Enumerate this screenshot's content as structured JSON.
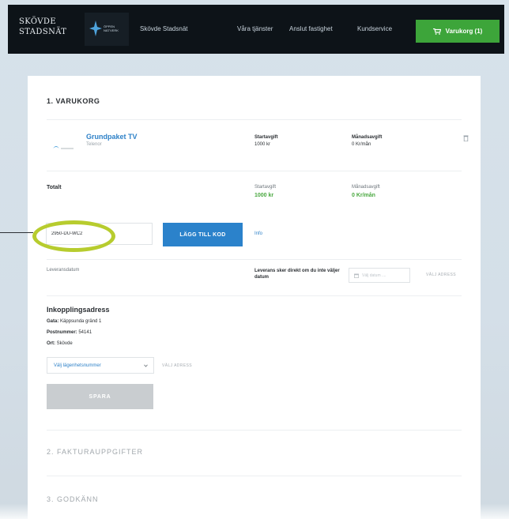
{
  "header": {
    "logo_line1": "SKÖVDE",
    "logo_line2": "STADSNÄT",
    "logo_mark_text": "ÖPPEN NÄTVERK",
    "nav": [
      "Skövde Stadsnät",
      "Våra tjänster",
      "Anslut fastighet",
      "Kundservice"
    ],
    "cart_label": "Varukorg (1)",
    "accent_color": "#3da53a"
  },
  "cart": {
    "section_title": "1. VARUKORG",
    "product": {
      "name": "Grundpaket TV",
      "subtitle": "Telenor",
      "startfee_label": "Startavgift",
      "startfee_value": "1000 kr",
      "monthly_label": "Månadsavgift",
      "monthly_value": "0 Kr/mån"
    },
    "total": {
      "label": "Totalt",
      "startfee_label": "Startavgift",
      "startfee_value": "1000 kr",
      "monthly_label": "Månadsavgift",
      "monthly_value": "0 Kr/mån"
    },
    "promo": {
      "code_value": "2950-DU-WC2",
      "button_label": "LÄGG TILL KOD",
      "info_link": "Info"
    },
    "delivery": {
      "date_label": "Leveransdatum",
      "instruction": "Leverans sker direkt om du inte väljer datum",
      "date_placeholder": "Välj datum ....",
      "link": "VÄLJ ADRESS"
    },
    "address": {
      "title": "Inkopplingsadress",
      "street_label": "Gata:",
      "street_value": "Käppsunda gränd 1",
      "postal_label": "Postnummer:",
      "postal_value": "54141",
      "city_label": "Ort:",
      "city_value": "Skövde",
      "select_value": "Välj lägenhetsnummer",
      "select_link": "VÄLJ ADRESS",
      "save_label": "SPARA"
    }
  },
  "sections": {
    "billing": "2. FAKTURAUPPGIFTER",
    "approve": "3. GODKÄNN"
  },
  "icons": {
    "cart": "cart-icon",
    "trash": "trash-icon",
    "calendar": "calendar-icon",
    "chevron": "chevron-down-icon"
  }
}
